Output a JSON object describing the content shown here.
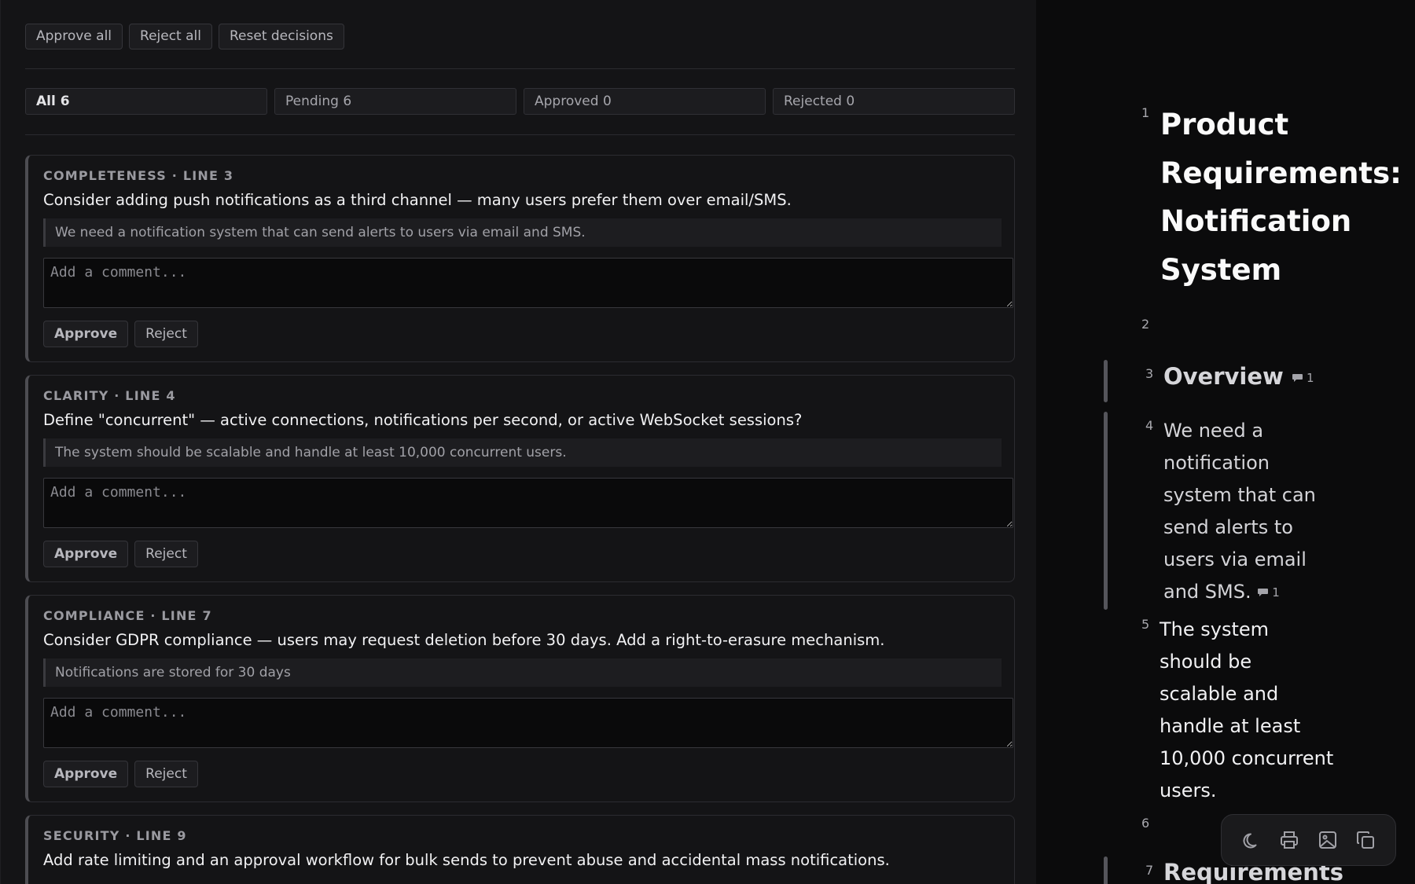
{
  "toolbar": {
    "approve_all": "Approve all",
    "reject_all": "Reject all",
    "reset_decisions": "Reset decisions"
  },
  "filters": [
    {
      "label": "All 6",
      "active": true
    },
    {
      "label": "Pending 6",
      "active": false
    },
    {
      "label": "Approved 0",
      "active": false
    },
    {
      "label": "Rejected 0",
      "active": false
    }
  ],
  "cards": [
    {
      "meta": "COMPLETENESS · LINE 3",
      "text": "Consider adding push notifications as a third channel — many users prefer them over email/SMS.",
      "quote": "We need a notification system that can send alerts to users via email and SMS.",
      "comment_placeholder": "Add a comment...",
      "approve": "Approve",
      "reject": "Reject"
    },
    {
      "meta": "CLARITY · LINE 4",
      "text": "Define \"concurrent\" — active connections, notifications per second, or active WebSocket sessions?",
      "quote": "The system should be scalable and handle at least 10,000 concurrent users.",
      "comment_placeholder": "Add a comment...",
      "approve": "Approve",
      "reject": "Reject"
    },
    {
      "meta": "COMPLIANCE · LINE 7",
      "text": "Consider GDPR compliance — users may request deletion before 30 days. Add a right-to-erasure mechanism.",
      "quote": "Notifications are stored for 30 days",
      "comment_placeholder": "Add a comment...",
      "approve": "Approve",
      "reject": "Reject"
    },
    {
      "meta": "SECURITY · LINE 9",
      "text": "Add rate limiting and an approval workflow for bulk sends to prevent abuse and accidental mass notifications."
    }
  ],
  "document": {
    "line_numbers": [
      "1",
      "2",
      "3",
      "4",
      "5",
      "6",
      "7"
    ],
    "title_lines": [
      "Product",
      "Requirements:",
      "Notification",
      "System"
    ],
    "overview_heading": "Overview",
    "overview_comment_count": "1",
    "para1_lines": [
      "We need a",
      "notification",
      "system that can",
      "send alerts to",
      "users via email",
      "and SMS."
    ],
    "para1_comment_count": "1",
    "para2_lines": [
      "The system",
      "should be",
      "scalable and",
      "handle at least",
      "10,000 concurrent",
      "users."
    ],
    "requirements_heading": "Requirements"
  },
  "floating_toolbar": {
    "icons": [
      "moon-icon",
      "print-icon",
      "image-icon",
      "copy-icon"
    ]
  }
}
